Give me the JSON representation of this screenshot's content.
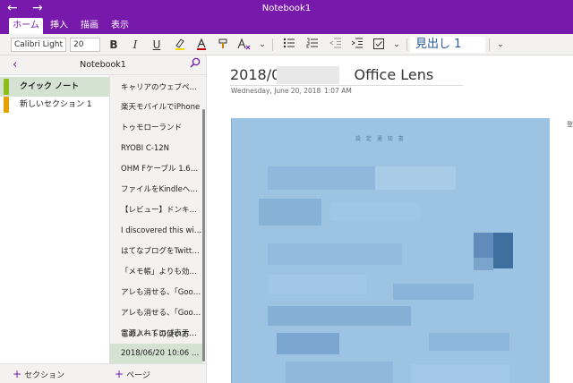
{
  "titlebar": {
    "back_icon": "arrow-left-icon",
    "forward_icon": "arrow-right-icon",
    "title": "Notebook1"
  },
  "ribbon": {
    "tabs": [
      {
        "label": "ホーム",
        "active": true
      },
      {
        "label": "挿入",
        "active": false
      },
      {
        "label": "描画",
        "active": false
      },
      {
        "label": "表示",
        "active": false
      }
    ]
  },
  "toolbar": {
    "font_name": "Calibri Light",
    "font_size": "20",
    "bold": "B",
    "italic": "I",
    "underline": "U",
    "highlight_icon": "highlighter-icon",
    "font_color_icon": "font-color-icon",
    "format_painter_icon": "format-painter-icon",
    "clear_format_icon": "clear-formatting-icon",
    "bullets_icon": "bullet-list-icon",
    "numbering_icon": "numbered-list-icon",
    "outdent_icon": "outdent-icon",
    "indent_icon": "indent-icon",
    "todo_icon": "checkbox-icon",
    "style_label": "見出し 1",
    "more_icon": "chevron-down-icon",
    "accent_color": "#7719aa"
  },
  "nav": {
    "notebook_name": "Notebook1",
    "back_icon": "chevron-left-icon",
    "search_icon": "search-icon",
    "sections": [
      {
        "label": "クイック ノート",
        "color": "#8cbd18",
        "selected": true
      },
      {
        "label": "新しいセクション 1",
        "color": "#e8a000",
        "selected": false
      }
    ],
    "pages": [
      {
        "label": "キャリアのウェブページから...",
        "selected": false
      },
      {
        "label": "楽天モバイルでiPhone",
        "selected": false
      },
      {
        "label": "トゥモローランド",
        "selected": false
      },
      {
        "label": "RYOBI C-12N",
        "selected": false
      },
      {
        "label": "OHM Fケーブル 1.6mm3...",
        "selected": false
      },
      {
        "label": "ファイルをKindleへ送る方...",
        "selected": false
      },
      {
        "label": "【レビュー】ドンキの格安4K...",
        "selected": false
      },
      {
        "label": "I discovered this with C...",
        "selected": false
      },
      {
        "label": "はてなブログをTwitterに自...",
        "selected": false
      },
      {
        "label": "「メモ帳」よりも効率よく文...",
        "selected": false
      },
      {
        "label": "アレも消せる、「Google Pl...",
        "selected": false
      },
      {
        "label": "アレも消せる、「Google Pl...",
        "selected": false
      },
      {
        "label": "電源入れてロゴ表示され...",
        "selected": false
      },
      {
        "label": "このノートの使い方",
        "selected": false
      },
      {
        "label": "2018/06/20 10:06 Offic...",
        "selected": true
      }
    ],
    "add_section": "セクション",
    "add_page": "ページ"
  },
  "page": {
    "title_prefix": "2018/0",
    "title_suffix": "Office Lens",
    "date": "Wednesday, June 20, 2018",
    "time": "1:07 AM",
    "doc_title": "設 定 通 知 書",
    "right_mark": "登"
  }
}
